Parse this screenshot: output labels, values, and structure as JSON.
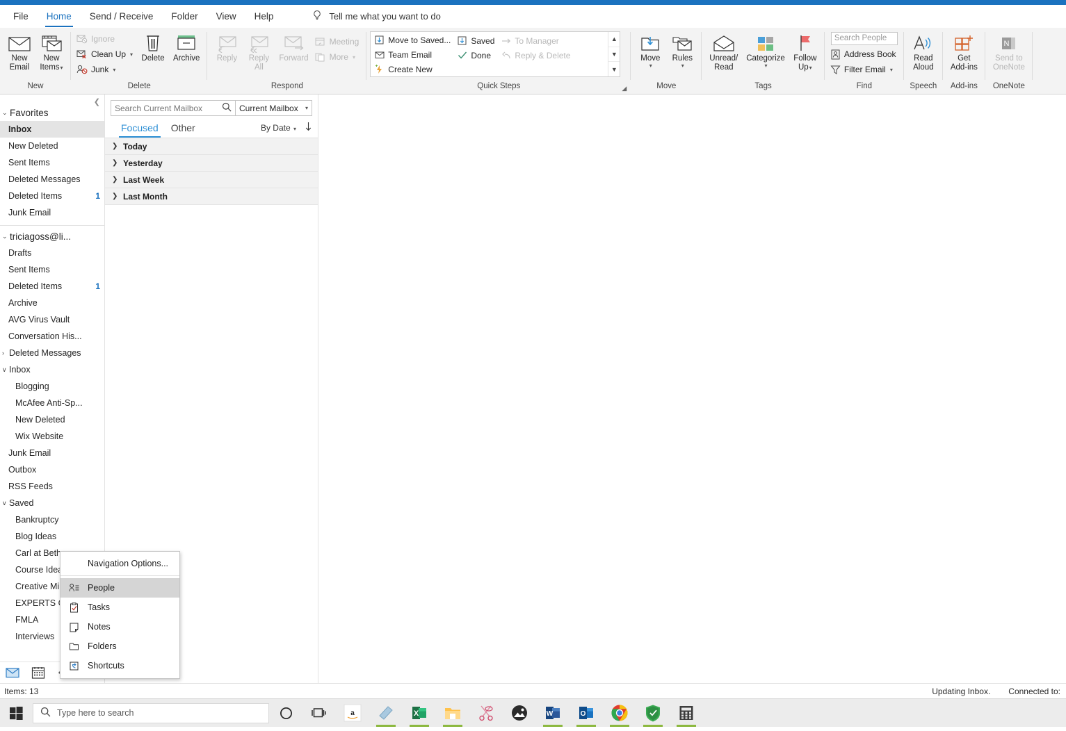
{
  "app": {
    "accent_color": "#1b72bf"
  },
  "ribbon_tabs": [
    {
      "label": "File",
      "active": false
    },
    {
      "label": "Home",
      "active": true
    },
    {
      "label": "Send / Receive",
      "active": false
    },
    {
      "label": "Folder",
      "active": false
    },
    {
      "label": "View",
      "active": false
    },
    {
      "label": "Help",
      "active": false
    }
  ],
  "tellme": {
    "placeholder": "Tell me what you want to do",
    "icon": "lightbulb-icon"
  },
  "ribbon": {
    "new": {
      "group_label": "New",
      "new_email": "New\nEmail",
      "new_email_line1": "New",
      "new_email_line2": "Email",
      "new_items_line1": "New",
      "new_items_line2": "Items"
    },
    "delete": {
      "group_label": "Delete",
      "ignore": "Ignore",
      "cleanup": "Clean Up",
      "junk": "Junk",
      "delete": "Delete",
      "archive": "Archive"
    },
    "respond": {
      "group_label": "Respond",
      "reply": "Reply",
      "reply_all_line1": "Reply",
      "reply_all_line2": "All",
      "forward": "Forward",
      "meeting": "Meeting",
      "more": "More"
    },
    "quick_steps": {
      "group_label": "Quick Steps",
      "items": [
        {
          "label": "Move to Saved...",
          "disabled": false
        },
        {
          "label": "Team Email",
          "disabled": false
        },
        {
          "label": "Create New",
          "disabled": false
        },
        {
          "label": "Saved",
          "disabled": false
        },
        {
          "label": "Done",
          "disabled": false
        },
        {
          "label": "To Manager",
          "disabled": true
        },
        {
          "label": "Reply & Delete",
          "disabled": true
        }
      ]
    },
    "move": {
      "group_label": "Move",
      "move": "Move",
      "rules": "Rules"
    },
    "tags": {
      "group_label": "Tags",
      "unread_read_line1": "Unread/",
      "unread_read_line2": "Read",
      "categorize": "Categorize",
      "followup_line1": "Follow",
      "followup_line2": "Up"
    },
    "find": {
      "group_label": "Find",
      "search_people_placeholder": "Search People",
      "address_book": "Address Book",
      "filter_email": "Filter Email"
    },
    "speech": {
      "group_label": "Speech",
      "read_aloud_line1": "Read",
      "read_aloud_line2": "Aloud"
    },
    "addins": {
      "group_label": "Add-ins",
      "get_addins_line1": "Get",
      "get_addins_line2": "Add-ins"
    },
    "onenote": {
      "group_label": "OneNote",
      "send_line1": "Send to",
      "send_line2": "OneNote"
    }
  },
  "nav": {
    "collapse_icon": "chevron-left-icon",
    "favorites": {
      "label": "Favorites",
      "items": [
        {
          "label": "Inbox",
          "count": "",
          "selected": true
        },
        {
          "label": "New Deleted",
          "count": "",
          "selected": false
        },
        {
          "label": "Sent Items",
          "count": "",
          "selected": false
        },
        {
          "label": "Deleted Messages",
          "count": "",
          "selected": false
        },
        {
          "label": "Deleted Items",
          "count": "1",
          "selected": false
        },
        {
          "label": "Junk Email",
          "count": "",
          "selected": false
        }
      ]
    },
    "account": {
      "label": "triciagoss@li...",
      "items": [
        {
          "label": "Drafts",
          "count": "",
          "indent": 1,
          "chevron": ""
        },
        {
          "label": "Sent Items",
          "count": "",
          "indent": 1,
          "chevron": ""
        },
        {
          "label": "Deleted Items",
          "count": "1",
          "indent": 1,
          "chevron": ""
        },
        {
          "label": "Archive",
          "count": "",
          "indent": 1,
          "chevron": ""
        },
        {
          "label": "AVG Virus Vault",
          "count": "",
          "indent": 1,
          "chevron": ""
        },
        {
          "label": "Conversation His...",
          "count": "",
          "indent": 1,
          "chevron": ""
        },
        {
          "label": "Deleted Messages",
          "count": "",
          "indent": 0,
          "chevron": "›"
        },
        {
          "label": "Inbox",
          "count": "",
          "indent": 0,
          "chevron": "∨"
        },
        {
          "label": "Blogging",
          "count": "",
          "indent": 2,
          "chevron": ""
        },
        {
          "label": "McAfee Anti-Sp...",
          "count": "",
          "indent": 2,
          "chevron": ""
        },
        {
          "label": "New Deleted",
          "count": "",
          "indent": 2,
          "chevron": ""
        },
        {
          "label": "Wix Website",
          "count": "",
          "indent": 2,
          "chevron": ""
        },
        {
          "label": "Junk Email",
          "count": "",
          "indent": 1,
          "chevron": ""
        },
        {
          "label": "Outbox",
          "count": "",
          "indent": 1,
          "chevron": ""
        },
        {
          "label": "RSS Feeds",
          "count": "",
          "indent": 1,
          "chevron": ""
        },
        {
          "label": "Saved",
          "count": "",
          "indent": 0,
          "chevron": "∨"
        },
        {
          "label": "Bankruptcy",
          "count": "",
          "indent": 2,
          "chevron": ""
        },
        {
          "label": "Blog Ideas",
          "count": "",
          "indent": 2,
          "chevron": ""
        },
        {
          "label": "Carl at Beth",
          "count": "",
          "indent": 2,
          "chevron": ""
        },
        {
          "label": "Course Idea",
          "count": "",
          "indent": 2,
          "chevron": ""
        },
        {
          "label": "Creative Mi",
          "count": "",
          "indent": 2,
          "chevron": ""
        },
        {
          "label": "EXPERTS Co",
          "count": "",
          "indent": 2,
          "chevron": ""
        },
        {
          "label": "FMLA",
          "count": "",
          "indent": 2,
          "chevron": ""
        },
        {
          "label": "Interviews",
          "count": "",
          "indent": 2,
          "chevron": ""
        }
      ]
    },
    "bottom_bar": [
      {
        "icon": "mail-icon",
        "active": true
      },
      {
        "icon": "calendar-icon",
        "active": false
      },
      {
        "icon": "overflow-dots-icon",
        "active": false
      }
    ]
  },
  "context_menu": {
    "header": "Navigation Options...",
    "items": [
      {
        "label": "People",
        "icon": "people-icon",
        "highlight": true
      },
      {
        "label": "Tasks",
        "icon": "tasks-icon",
        "highlight": false
      },
      {
        "label": "Notes",
        "icon": "notes-icon",
        "highlight": false
      },
      {
        "label": "Folders",
        "icon": "folder-icon",
        "highlight": false
      },
      {
        "label": "Shortcuts",
        "icon": "shortcuts-icon",
        "highlight": false
      }
    ]
  },
  "list_pane": {
    "search_placeholder": "Search Current Mailbox",
    "search_icon": "search-icon",
    "scope": "Current Mailbox",
    "tabs": [
      {
        "label": "Focused",
        "active": true
      },
      {
        "label": "Other",
        "active": false
      }
    ],
    "sort_by": "By Date",
    "sort_direction_icon": "arrow-down-icon",
    "groups": [
      {
        "label": "Today"
      },
      {
        "label": "Yesterday"
      },
      {
        "label": "Last Week"
      },
      {
        "label": "Last Month"
      }
    ]
  },
  "status_bar": {
    "items_count": "Items: 13",
    "updating": "Updating Inbox.",
    "connected": "Connected to:"
  },
  "taskbar": {
    "start_icon": "windows-start-icon",
    "search_placeholder": "Type here to search",
    "search_icon": "search-icon",
    "cortana_icon": "cortana-circle-icon",
    "taskview_icon": "task-view-icon",
    "apps": [
      {
        "name": "amazon-icon",
        "running": false
      },
      {
        "name": "lightshot-icon",
        "running": true
      },
      {
        "name": "excel-icon",
        "running": true
      },
      {
        "name": "file-explorer-icon",
        "running": true
      },
      {
        "name": "snipping-tool-icon",
        "running": false
      },
      {
        "name": "photos-icon",
        "running": false
      },
      {
        "name": "word-icon",
        "running": true
      },
      {
        "name": "outlook-icon",
        "running": true
      },
      {
        "name": "chrome-icon",
        "running": true
      },
      {
        "name": "avg-icon",
        "running": true
      },
      {
        "name": "calculator-icon",
        "running": true
      }
    ]
  }
}
